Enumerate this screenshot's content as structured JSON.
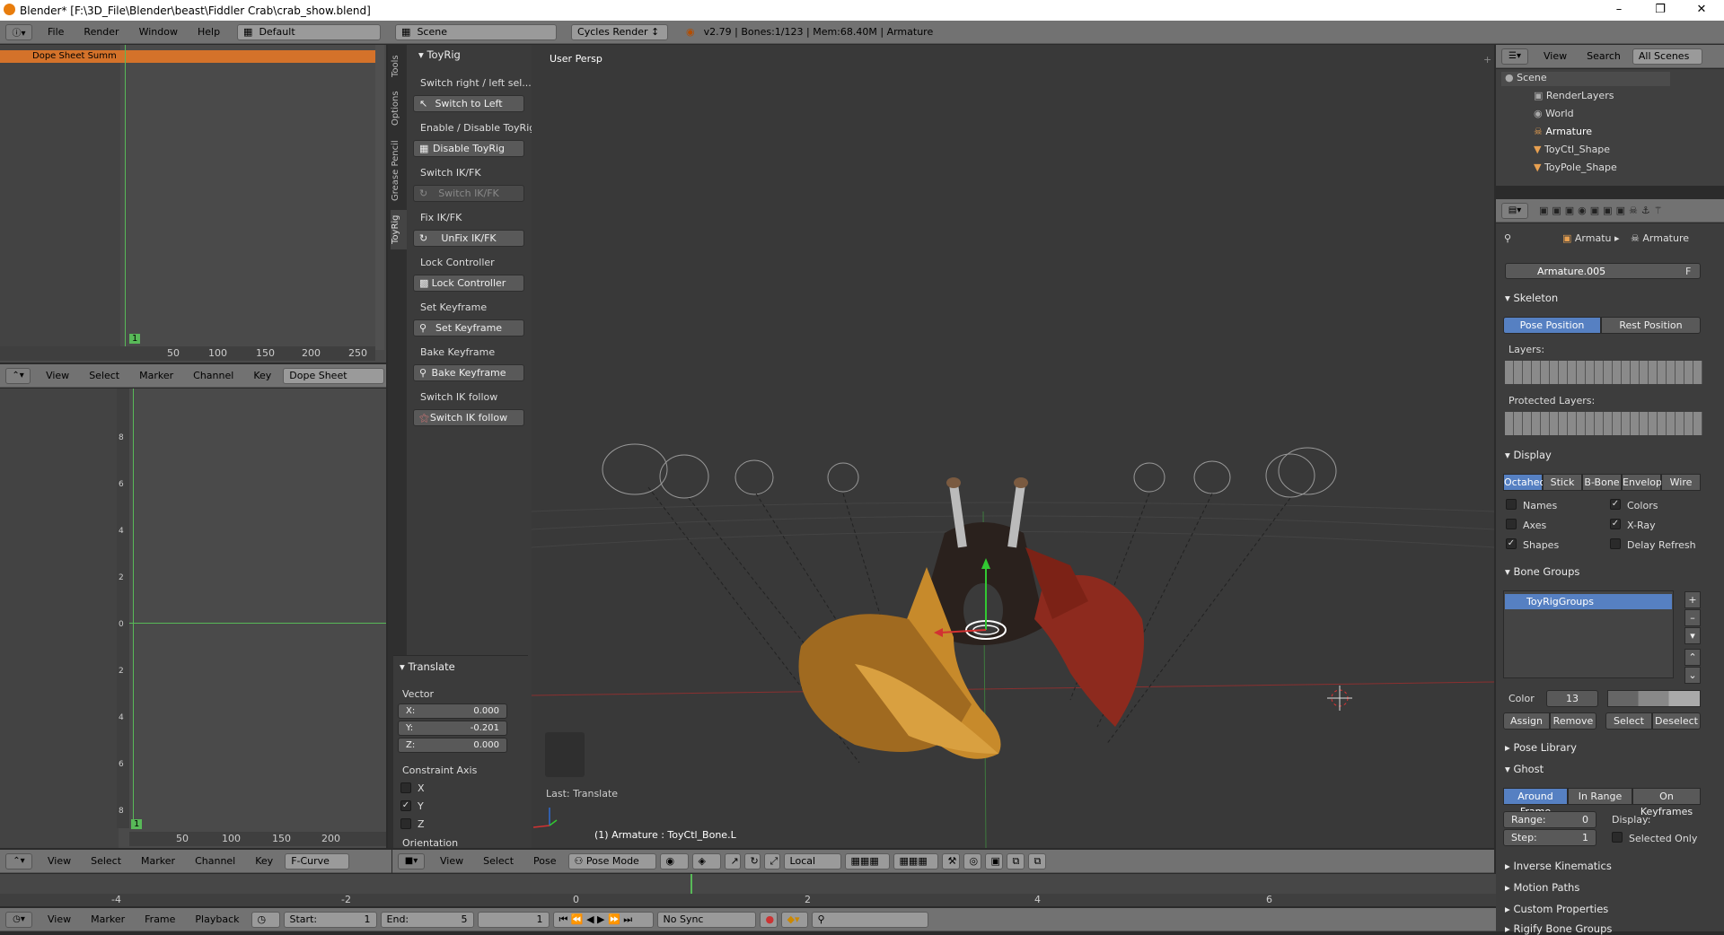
{
  "window": {
    "title": "Blender* [F:\\3D_File\\Blender\\beast\\Fiddler Crab\\crab_show.blend]"
  },
  "info_header": {
    "menus": [
      "File",
      "Render",
      "Window",
      "Help"
    ],
    "layout": "Default",
    "scene": "Scene",
    "engine": "Cycles Render",
    "stats": "v2.79 | Bones:1/123 | Mem:68.40M | Armature"
  },
  "dopesheet_top": {
    "channel": "Dope Sheet Summ",
    "ticks": [
      "50",
      "100",
      "150",
      "200",
      "250"
    ],
    "frame_marker": "1",
    "menus": [
      "View",
      "Select",
      "Marker",
      "Channel",
      "Key"
    ],
    "mode": "Dope Sheet"
  },
  "graph_editor": {
    "y_ticks": [
      "8",
      "6",
      "4",
      "2",
      "0",
      "2",
      "4",
      "6",
      "8"
    ],
    "x_ticks": [
      "50",
      "100",
      "150",
      "200"
    ],
    "frame_marker": "1",
    "menus": [
      "View",
      "Select",
      "Marker",
      "Channel",
      "Key"
    ],
    "mode": "F-Curve"
  },
  "toolshelf": {
    "tabs": [
      "Tools",
      "Options",
      "Grease Pencil",
      "ToyRig"
    ],
    "panel_title": "ToyRig",
    "items": [
      {
        "label": "Switch right / left sel...",
        "button": "Switch to Left"
      },
      {
        "label": "Enable / Disable ToyRig",
        "button": "Disable ToyRig"
      },
      {
        "label": "Switch IK/FK",
        "button": "Switch IK/FK"
      },
      {
        "label": "Fix IK/FK",
        "button": "UnFix IK/FK"
      },
      {
        "label": "Lock Controller",
        "button": "Lock Controller"
      },
      {
        "label": "Set Keyframe",
        "button": "Set Keyframe"
      },
      {
        "label": "Bake Keyframe",
        "button": "Bake Keyframe"
      },
      {
        "label": "Switch IK follow",
        "button": "Switch IK follow"
      }
    ],
    "translate": {
      "title": "Translate",
      "vector_label": "Vector",
      "x": "X:",
      "x_val": "0.000",
      "y": "Y:",
      "y_val": "-0.201",
      "z": "Z:",
      "z_val": "0.000",
      "constraint_label": "Constraint Axis",
      "axes": [
        "X",
        "Y",
        "Z"
      ],
      "orientation": "Orientation"
    }
  },
  "viewport": {
    "view_name": "User Persp",
    "last_op": "Last: Translate",
    "object_info": "(1) Armature : ToyCtl_Bone.L",
    "menus": [
      "View",
      "Select",
      "Pose"
    ],
    "mode": "Pose Mode",
    "orientation": "Local"
  },
  "outliner": {
    "menus": [
      "View",
      "Search"
    ],
    "filter": "All Scenes",
    "items": [
      "Scene",
      "RenderLayers",
      "World",
      "Armature",
      "ToyCtl_Shape",
      "ToyPole_Shape"
    ]
  },
  "properties": {
    "breadcrumb1": "Armatu",
    "breadcrumb2": "Armature",
    "datablock": "Armature.005",
    "fake_user": "F",
    "skeleton": "Skeleton",
    "pose_position": "Pose Position",
    "rest_position": "Rest Position",
    "layers": "Layers:",
    "protected_layers": "Protected Layers:",
    "display": "Display",
    "display_types": [
      "Octahec",
      "Stick",
      "B-Bone",
      "Envelop",
      "Wire"
    ],
    "names": "Names",
    "colors": "Colors",
    "axes": "Axes",
    "xray": "X-Ray",
    "shapes": "Shapes",
    "delay": "Delay Refresh",
    "bone_groups": "Bone Groups",
    "group_item": "ToyRigGroups",
    "color": "Color",
    "color_val": "13",
    "assign": "Assign",
    "remove": "Remove",
    "select": "Select",
    "deselect": "Deselect",
    "pose_library": "Pose Library",
    "ghost": "Ghost",
    "ghost_types": [
      "Around Frame",
      "In Range",
      "On Keyframes"
    ],
    "range": "Range:",
    "range_val": "0",
    "step": "Step:",
    "step_val": "1",
    "display_lbl": "Display:",
    "selected_only": "Selected Only",
    "ik": "Inverse Kinematics",
    "motion_paths": "Motion Paths",
    "custom_props": "Custom Properties",
    "rigify": "Rigify Bone Groups"
  },
  "timeline": {
    "ticks": [
      "-4",
      "-2",
      "0",
      "2",
      "4",
      "6"
    ],
    "menus": [
      "View",
      "Marker",
      "Frame",
      "Playback"
    ],
    "start": "Start:",
    "start_val": "1",
    "end": "End:",
    "end_val": "5",
    "current": "1",
    "sync": "No Sync"
  }
}
